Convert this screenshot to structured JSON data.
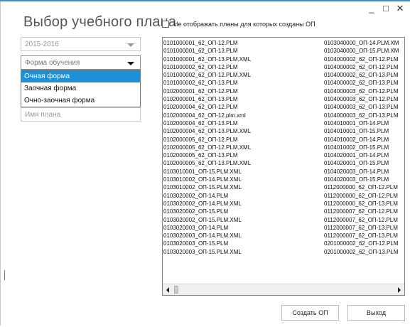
{
  "window": {
    "title": "Выбор учебного плана",
    "controls": {
      "minimize": "_",
      "maximize": "□",
      "close": "✕"
    }
  },
  "filters": {
    "hide_plans_label": "Не отображать планы  для которых созданы ОП",
    "hide_plans_checked": false,
    "year": {
      "value": "2015-2016"
    },
    "study_form": {
      "placeholder": "Форма обучения",
      "options": [
        "Очная форма",
        "Заочная форма",
        "Очно-заочная форма"
      ],
      "highlighted": "Очная форма"
    },
    "plan_name": {
      "placeholder": "Имя плана"
    }
  },
  "plan_list": {
    "column1": [
      "0101000001_62_ОП-12.PLM",
      "0101000001_62_ОП-13.PLM",
      "0101000001_62_ОП-13.PLM.XML",
      "0101000002_62_ОП-12.PLM",
      "0101000002_62_ОП-12.PLM.XML",
      "0101000002_62_ОП-13.PLM",
      "0102000001_62_ОП-12.PLM",
      "0102000001_62_ОП-13.PLM",
      "0102000004_62_ОП-12.PLM",
      "0102000004_62_ОП-12.plm.xml",
      "0102000004_62_ОП-13.PLM",
      "0102000004_62_ОП-13.PLM.XML",
      "0102000005_62_ОП-12.PLM",
      "0102000005_62_ОП-12.PLM.XML",
      "0102000005_62_ОП-13.PLM",
      "0102000005_62_ОП-13.PLM.XML",
      "0103010001_ОП-15.PLM.XML",
      "0103010002_ОП-14.PLM.XML",
      "0103010002_ОП-15.PLM.XML",
      "0103020002_ОП-14.PLM",
      "0103020002_ОП-14.PLM.XML",
      "0103020002_ОП-15.PLM",
      "0103020002_ОП-15.PLM.XML",
      "0103020003_ОП-14.PLM",
      "0103020003_ОП-14.PLM.XML",
      "0103020003_ОП-15.PLM",
      "0103020003_ОП-15.PLM.XML"
    ],
    "column2": [
      "0103040000_ОП-14.PLM.XM",
      "0103040000_ОП-15.PLM.XM",
      "0104000002_62_ОП-12.PLM",
      "0104000002_62_ОП-12.PLM",
      "0104000002_62_ОП-13.PLM",
      "0104000002_62_ОП-13.PLM",
      "0104000003_62_ОП-12.PLM",
      "0104000003_62_ОП-12.PLM",
      "0104000003_62_ОП-13.PLM",
      "0104000003_62_ОП-13.PLM",
      "0104010001_ОП-14.PLM",
      "0104010001_ОП-15.PLM",
      "0104010002_ОП-14.PLM",
      "0104010002_ОП-15.PLM",
      "0104020001_ОП-14.PLM",
      "0104020001_ОП-15.PLM",
      "0104020003_ОП-14.PLM",
      "0104020003_ОП-15.PLM",
      "0112000000_62_ОП-12.PLM",
      "0112000000_62_ОП-12.PLM",
      "0112000000_62_ОП-13.PLM",
      "0112000007_62_ОП-12.PLM",
      "0112000007_62_ОП-12.PLM",
      "0112000007_62_ОП-13.PLM",
      "0112000007_62_ОП-13.PLM",
      "0201000002_62_ОП-12.PLM",
      "0201000002_62_ОП-13.PLM"
    ]
  },
  "buttons": {
    "create_op": "Создать ОП",
    "exit": "Выход"
  },
  "colors": {
    "accent": "#3a8fd3",
    "selection": "#1e90d6"
  }
}
